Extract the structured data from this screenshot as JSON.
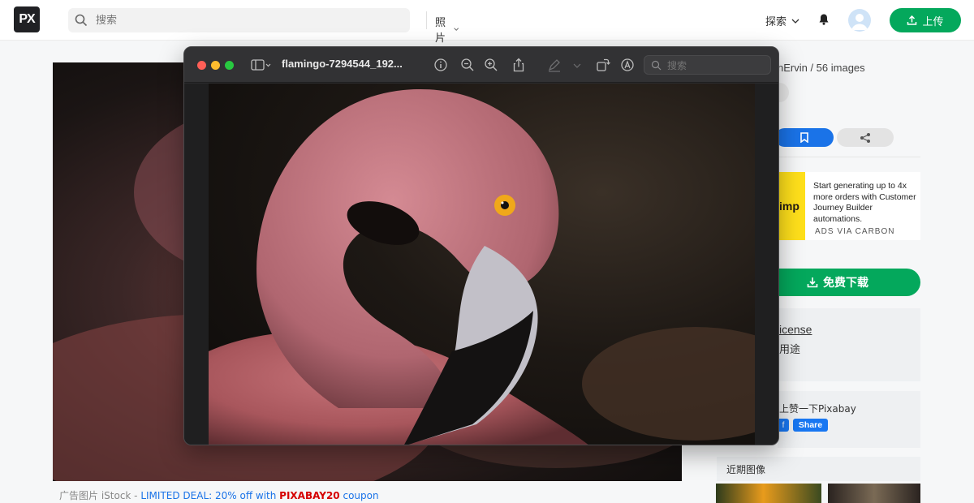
{
  "header": {
    "logo": "PX",
    "search_placeholder": "搜索",
    "media_type": "照片",
    "explore": "探索",
    "upload": "上传"
  },
  "main": {
    "ad_prefix": "广告图片 iStock - ",
    "ad_deal": "LIMITED DEAL: 20% off with ",
    "ad_code": "PIXABAY20",
    "ad_suffix": " coupon"
  },
  "sidebar": {
    "author": "nErvin / 56 images",
    "carbon_logo": "imp",
    "carbon_text": "Start generating up to 4x more orders with Customer Journey Builder automations.",
    "carbon_via": "ADS VIA CARBON",
    "download": "免费下载",
    "license_link": "icense",
    "license_text": "用途",
    "like_text": "上赞一下Pixabay",
    "fb_small": "f",
    "share": "Share",
    "recent": "近期图像"
  },
  "preview": {
    "title": "flamingo-7294544_192...",
    "search_placeholder": "搜索"
  },
  "colors": {
    "brand_green": "#04a85c",
    "accent_blue": "#1a73e8",
    "coupon_red": "#d50000"
  }
}
